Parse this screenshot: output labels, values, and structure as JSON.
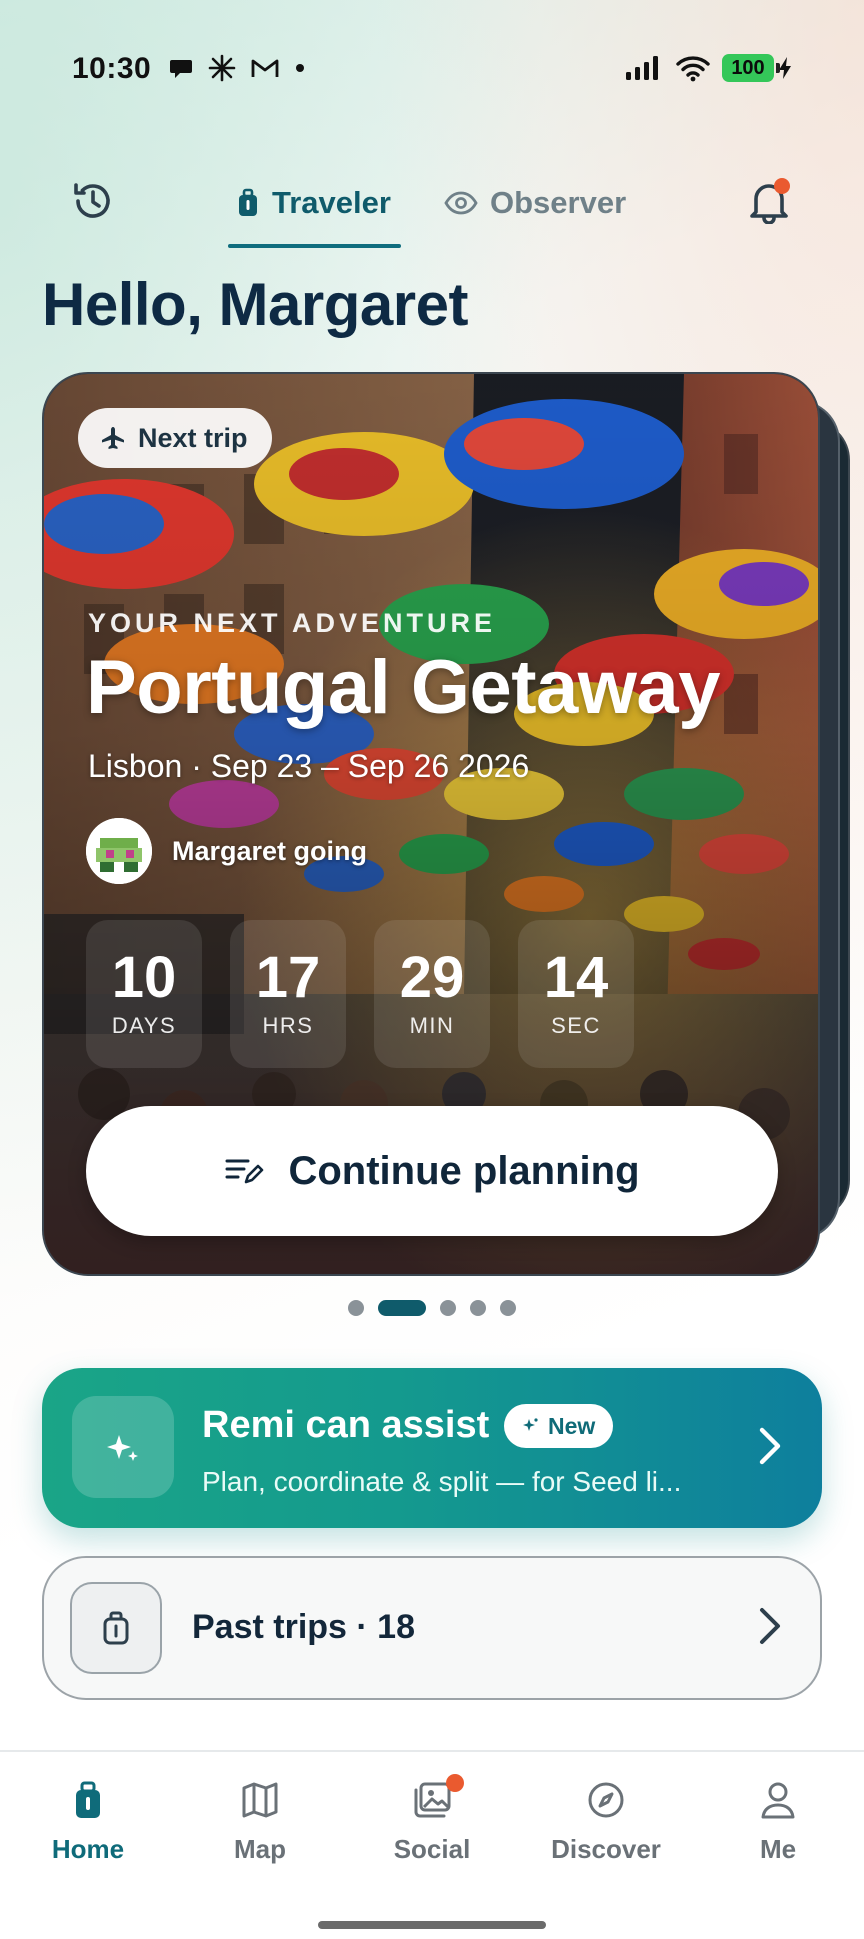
{
  "status_bar": {
    "time": "10:30",
    "battery": "100"
  },
  "header": {
    "tabs": [
      {
        "label": "Traveler",
        "active": true
      },
      {
        "label": "Observer",
        "active": false
      }
    ],
    "has_notification": true
  },
  "greeting": "Hello, Margaret",
  "trip_card": {
    "pill_label": "Next trip",
    "eyebrow": "YOUR NEXT ADVENTURE",
    "title": "Portugal Getaway",
    "subtitle": "Lisbon · Sep 23 – Sep 26 2026",
    "going": "Margaret going",
    "countdown": [
      {
        "value": "10",
        "label": "DAYS"
      },
      {
        "value": "17",
        "label": "HRS"
      },
      {
        "value": "29",
        "label": "MIN"
      },
      {
        "value": "14",
        "label": "SEC"
      }
    ],
    "cta_label": "Continue planning"
  },
  "pager": {
    "count": 5,
    "active_index": 1
  },
  "assist": {
    "title": "Remi can assist",
    "badge": "New",
    "subtitle": "Plan, coordinate & split — for Seed li..."
  },
  "past_trips": {
    "label": "Past trips · 18"
  },
  "bottom_nav": [
    {
      "label": "Home",
      "icon": "luggage-icon",
      "active": true
    },
    {
      "label": "Map",
      "icon": "map-icon",
      "active": false
    },
    {
      "label": "Social",
      "icon": "photos-icon",
      "active": false
    },
    {
      "label": "Discover",
      "icon": "compass-icon",
      "active": false
    },
    {
      "label": "Me",
      "icon": "person-icon",
      "active": false
    }
  ],
  "colors": {
    "accent": "#0f6b7a",
    "assist_gradient_start": "#1aa587",
    "assist_gradient_end": "#0e7f9d",
    "notification_dot": "#ea5a2f"
  }
}
